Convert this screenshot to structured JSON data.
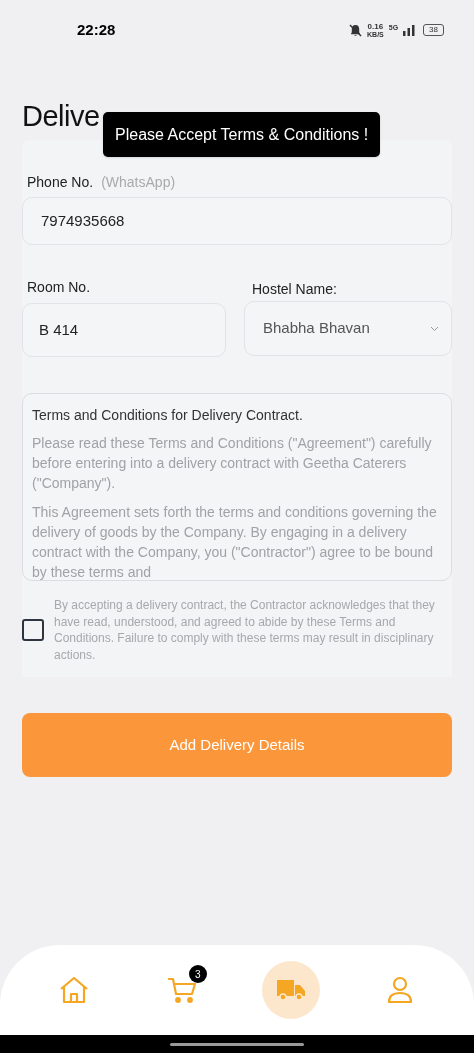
{
  "status_bar": {
    "time": "22:28",
    "speed": "0.16",
    "speed_unit": "KB/S",
    "network": "5G",
    "battery": "38"
  },
  "title": "Delive",
  "toast": "Please Accept Terms & Conditions !",
  "phone": {
    "label": "Phone No.",
    "hint": "(WhatsApp)",
    "value": "7974935668"
  },
  "room": {
    "label": "Room No.",
    "value": "B 414"
  },
  "hostel": {
    "label": "Hostel Name:",
    "value": "Bhabha Bhavan"
  },
  "terms": {
    "heading": "Terms and Conditions for Delivery Contract.",
    "paragraphs": [
      "Please read these Terms and Conditions (\"Agreement\") carefully before entering into a delivery contract with Geetha Caterers (\"Company\").",
      "This Agreement sets forth the terms and conditions governing the delivery of goods by the Company. By engaging in a delivery contract with the Company, you (\"Contractor\") agree to be bound by these terms and"
    ]
  },
  "accept": {
    "checked": false,
    "text": "By accepting a delivery contract, the Contractor acknowledges that they have read, understood, and agreed to abide by these Terms and Conditions. Failure to comply with these terms may result in disciplinary actions."
  },
  "submit": "Add Delivery Details",
  "nav": [
    {
      "kind": "home",
      "selected": false
    },
    {
      "kind": "cart",
      "selected": false,
      "badge": "3"
    },
    {
      "kind": "delivery",
      "selected": true
    },
    {
      "kind": "profile",
      "selected": false
    }
  ]
}
